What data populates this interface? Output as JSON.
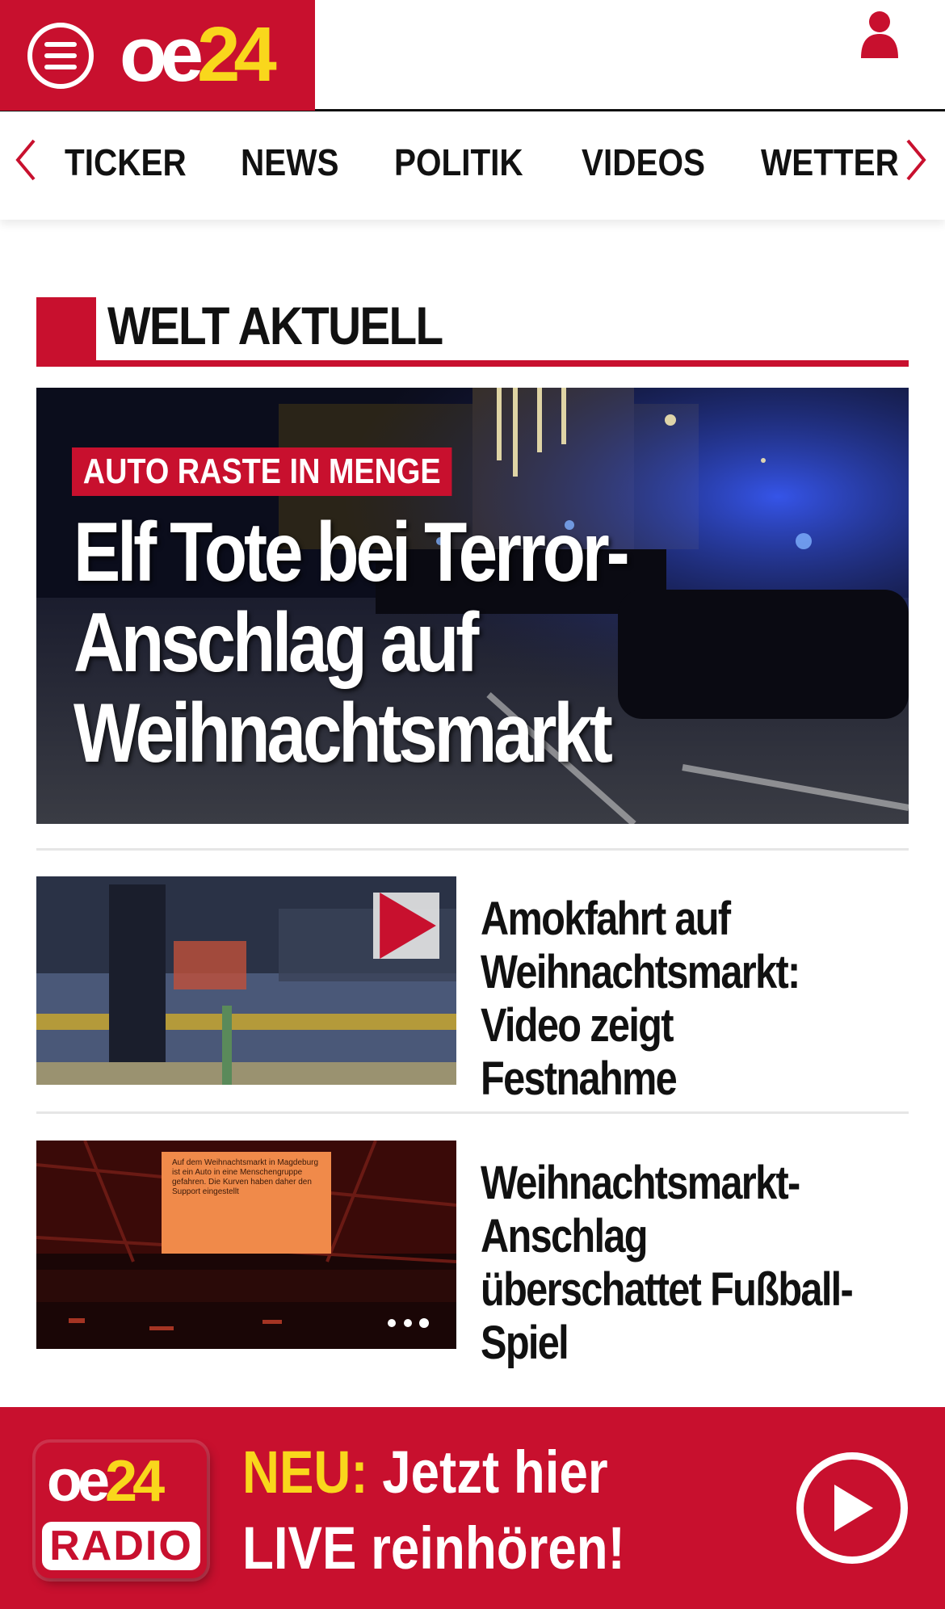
{
  "header": {
    "menu_icon": "hamburger-menu-icon",
    "logo": {
      "oe": "oe",
      "num": "24"
    },
    "user_icon": "user-icon",
    "colors": {
      "brand_red": "#c8102e",
      "brand_yellow": "#f9d71c"
    }
  },
  "nav": {
    "items": [
      "TICKER",
      "NEWS",
      "POLITIK",
      "VIDEOS",
      "WETTER"
    ],
    "prev_icon": "chevron-left-icon",
    "next_icon": "chevron-right-icon"
  },
  "section": {
    "title": "WELT AKTUELL"
  },
  "hero": {
    "kicker": "AUTO RASTE IN MENGE",
    "headline": "Elf Tote bei Terror-Anschlag auf Weihnachtsmarkt"
  },
  "articles": [
    {
      "title": "Amokfahrt auf Weihnachtsmarkt: Video zeigt Festnahme",
      "has_video": true,
      "video_icon": "play-icon"
    },
    {
      "title": "Weihnachtsmarkt-Anschlag überschattet Fußball-Spiel",
      "has_video": false,
      "screen_text": "Auf dem Weihnachtsmarkt in Magdeburg ist ein Auto in eine Menschengruppe gefahren. Die Kurven haben daher den Support eingestellt"
    }
  ],
  "radio_banner": {
    "logo": {
      "oe": "oe",
      "num": "24",
      "radio": "RADIO"
    },
    "highlight": "NEU:",
    "line1": "Jetzt hier",
    "line2": "LIVE reinhören!",
    "play_icon": "play-circle-icon"
  }
}
